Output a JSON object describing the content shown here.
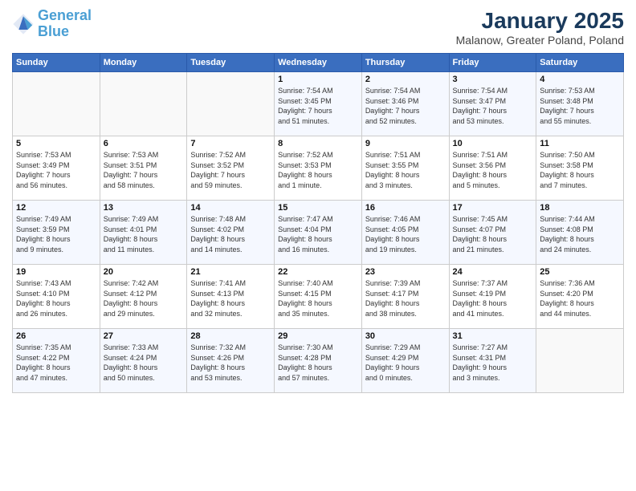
{
  "logo": {
    "line1": "General",
    "line2": "Blue"
  },
  "title": "January 2025",
  "subtitle": "Malanow, Greater Poland, Poland",
  "weekdays": [
    "Sunday",
    "Monday",
    "Tuesday",
    "Wednesday",
    "Thursday",
    "Friday",
    "Saturday"
  ],
  "weeks": [
    [
      {
        "day": "",
        "info": ""
      },
      {
        "day": "",
        "info": ""
      },
      {
        "day": "",
        "info": ""
      },
      {
        "day": "1",
        "info": "Sunrise: 7:54 AM\nSunset: 3:45 PM\nDaylight: 7 hours\nand 51 minutes."
      },
      {
        "day": "2",
        "info": "Sunrise: 7:54 AM\nSunset: 3:46 PM\nDaylight: 7 hours\nand 52 minutes."
      },
      {
        "day": "3",
        "info": "Sunrise: 7:54 AM\nSunset: 3:47 PM\nDaylight: 7 hours\nand 53 minutes."
      },
      {
        "day": "4",
        "info": "Sunrise: 7:53 AM\nSunset: 3:48 PM\nDaylight: 7 hours\nand 55 minutes."
      }
    ],
    [
      {
        "day": "5",
        "info": "Sunrise: 7:53 AM\nSunset: 3:49 PM\nDaylight: 7 hours\nand 56 minutes."
      },
      {
        "day": "6",
        "info": "Sunrise: 7:53 AM\nSunset: 3:51 PM\nDaylight: 7 hours\nand 58 minutes."
      },
      {
        "day": "7",
        "info": "Sunrise: 7:52 AM\nSunset: 3:52 PM\nDaylight: 7 hours\nand 59 minutes."
      },
      {
        "day": "8",
        "info": "Sunrise: 7:52 AM\nSunset: 3:53 PM\nDaylight: 8 hours\nand 1 minute."
      },
      {
        "day": "9",
        "info": "Sunrise: 7:51 AM\nSunset: 3:55 PM\nDaylight: 8 hours\nand 3 minutes."
      },
      {
        "day": "10",
        "info": "Sunrise: 7:51 AM\nSunset: 3:56 PM\nDaylight: 8 hours\nand 5 minutes."
      },
      {
        "day": "11",
        "info": "Sunrise: 7:50 AM\nSunset: 3:58 PM\nDaylight: 8 hours\nand 7 minutes."
      }
    ],
    [
      {
        "day": "12",
        "info": "Sunrise: 7:49 AM\nSunset: 3:59 PM\nDaylight: 8 hours\nand 9 minutes."
      },
      {
        "day": "13",
        "info": "Sunrise: 7:49 AM\nSunset: 4:01 PM\nDaylight: 8 hours\nand 11 minutes."
      },
      {
        "day": "14",
        "info": "Sunrise: 7:48 AM\nSunset: 4:02 PM\nDaylight: 8 hours\nand 14 minutes."
      },
      {
        "day": "15",
        "info": "Sunrise: 7:47 AM\nSunset: 4:04 PM\nDaylight: 8 hours\nand 16 minutes."
      },
      {
        "day": "16",
        "info": "Sunrise: 7:46 AM\nSunset: 4:05 PM\nDaylight: 8 hours\nand 19 minutes."
      },
      {
        "day": "17",
        "info": "Sunrise: 7:45 AM\nSunset: 4:07 PM\nDaylight: 8 hours\nand 21 minutes."
      },
      {
        "day": "18",
        "info": "Sunrise: 7:44 AM\nSunset: 4:08 PM\nDaylight: 8 hours\nand 24 minutes."
      }
    ],
    [
      {
        "day": "19",
        "info": "Sunrise: 7:43 AM\nSunset: 4:10 PM\nDaylight: 8 hours\nand 26 minutes."
      },
      {
        "day": "20",
        "info": "Sunrise: 7:42 AM\nSunset: 4:12 PM\nDaylight: 8 hours\nand 29 minutes."
      },
      {
        "day": "21",
        "info": "Sunrise: 7:41 AM\nSunset: 4:13 PM\nDaylight: 8 hours\nand 32 minutes."
      },
      {
        "day": "22",
        "info": "Sunrise: 7:40 AM\nSunset: 4:15 PM\nDaylight: 8 hours\nand 35 minutes."
      },
      {
        "day": "23",
        "info": "Sunrise: 7:39 AM\nSunset: 4:17 PM\nDaylight: 8 hours\nand 38 minutes."
      },
      {
        "day": "24",
        "info": "Sunrise: 7:37 AM\nSunset: 4:19 PM\nDaylight: 8 hours\nand 41 minutes."
      },
      {
        "day": "25",
        "info": "Sunrise: 7:36 AM\nSunset: 4:20 PM\nDaylight: 8 hours\nand 44 minutes."
      }
    ],
    [
      {
        "day": "26",
        "info": "Sunrise: 7:35 AM\nSunset: 4:22 PM\nDaylight: 8 hours\nand 47 minutes."
      },
      {
        "day": "27",
        "info": "Sunrise: 7:33 AM\nSunset: 4:24 PM\nDaylight: 8 hours\nand 50 minutes."
      },
      {
        "day": "28",
        "info": "Sunrise: 7:32 AM\nSunset: 4:26 PM\nDaylight: 8 hours\nand 53 minutes."
      },
      {
        "day": "29",
        "info": "Sunrise: 7:30 AM\nSunset: 4:28 PM\nDaylight: 8 hours\nand 57 minutes."
      },
      {
        "day": "30",
        "info": "Sunrise: 7:29 AM\nSunset: 4:29 PM\nDaylight: 9 hours\nand 0 minutes."
      },
      {
        "day": "31",
        "info": "Sunrise: 7:27 AM\nSunset: 4:31 PM\nDaylight: 9 hours\nand 3 minutes."
      },
      {
        "day": "",
        "info": ""
      }
    ]
  ]
}
